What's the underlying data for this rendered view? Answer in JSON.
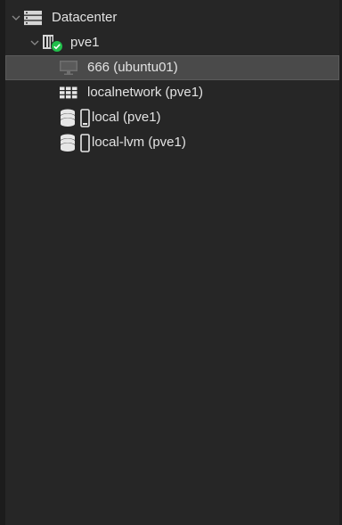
{
  "tree": {
    "datacenter": {
      "label": "Datacenter",
      "icon": "server-rack-icon",
      "expanded": true
    },
    "node": {
      "label": "pve1",
      "icon": "node-server-icon",
      "status": "online",
      "status_icon": "check-circle-icon",
      "expanded": true
    },
    "children": [
      {
        "label": "666 (ubuntu01)",
        "icon": "monitor-icon",
        "selected": true
      },
      {
        "label": "localnetwork (pve1)",
        "icon": "network-grid-icon",
        "selected": false
      },
      {
        "label": "local (pve1)",
        "icon": "storage-icon",
        "selected": false
      },
      {
        "label": "local-lvm (pve1)",
        "icon": "storage-icon",
        "selected": false
      }
    ]
  },
  "colors": {
    "background": "#262626",
    "text": "#e2e2e2",
    "selected_row": "#4a4a4a",
    "status_ok": "#21bf4b"
  }
}
